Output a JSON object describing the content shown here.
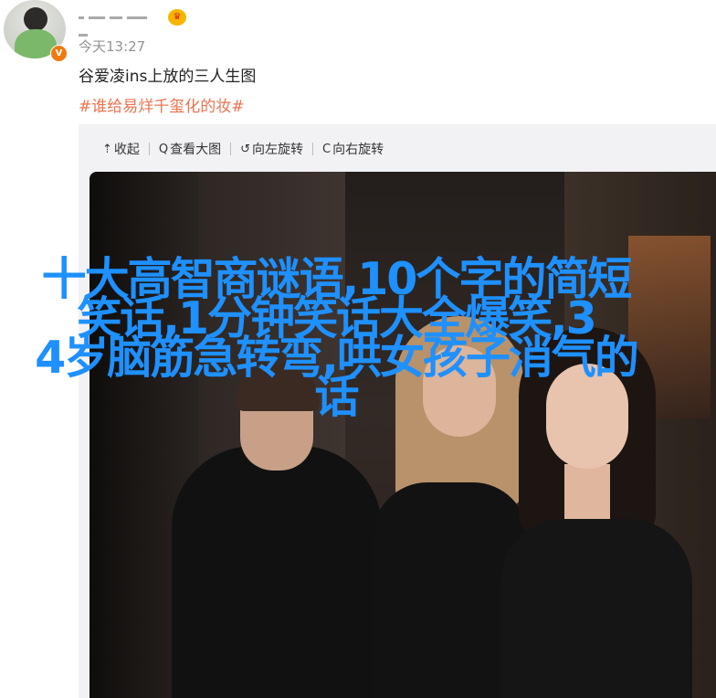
{
  "post": {
    "timestamp": "今天13:27",
    "text": "谷爱凌ins上放的三人生图",
    "tag": "#谁给易烊千玺化的妆#"
  },
  "toolbar": {
    "collapse_label": "收起",
    "view_large_label": "查看大图",
    "rotate_left_label": "向左旋转",
    "rotate_right_label": "向右旋转"
  },
  "overlay": {
    "lines": [
      "十大高智商谜语,10个字的简短",
      "笑话,1分钟笑话大全爆笑,3",
      "4岁脑筋急转弯,哄女孩子消气的",
      "话"
    ]
  },
  "colors": {
    "accent_tag": "#eb7350",
    "overlay_text": "#1e90ff",
    "verified_badge": "#f07a12"
  },
  "icons": [
    "user-avatar",
    "verified-icon",
    "vip-crown-icon",
    "collapse-icon",
    "zoom-icon",
    "rotate-left-icon",
    "rotate-right-icon"
  ]
}
